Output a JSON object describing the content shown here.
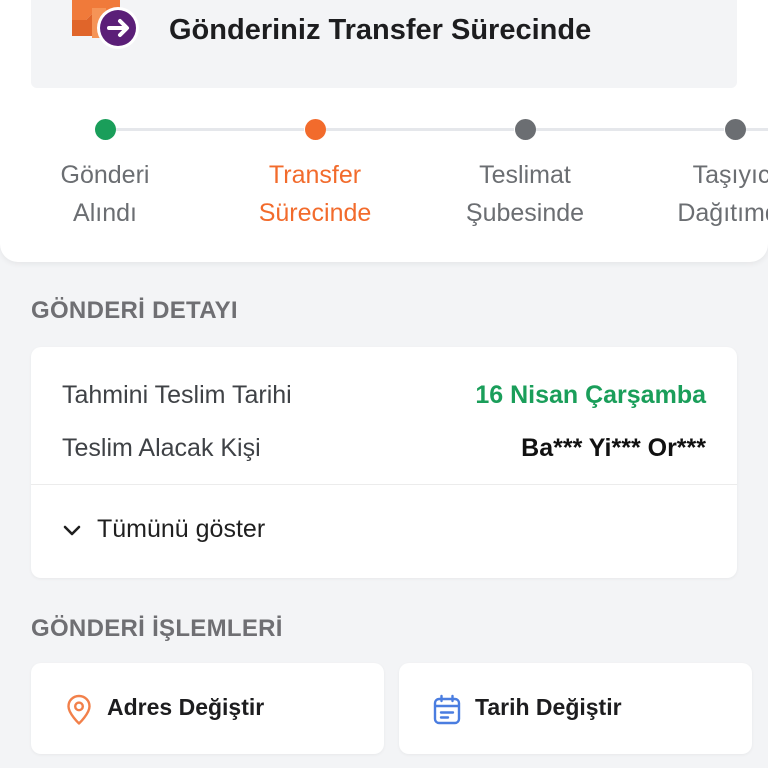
{
  "status": {
    "title": "Gönderiniz Transfer Sürecinde",
    "icon": "package-transfer-icon"
  },
  "tracking": {
    "steps": [
      {
        "line1": "Gönderi",
        "line2": "Alındı",
        "state": "completed",
        "color": "#1a9e5a"
      },
      {
        "line1": "Transfer",
        "line2": "Sürecinde",
        "state": "current",
        "color": "#f26b2c"
      },
      {
        "line1": "Teslimat",
        "line2": "Şubesinde",
        "state": "pending",
        "color": "#6b6e72"
      },
      {
        "line1": "Taşıyıcı",
        "line2": "Dağıtımda",
        "state": "pending",
        "color": "#6b6e72"
      }
    ]
  },
  "details": {
    "section_title": "GÖNDERİ DETAYI",
    "rows": [
      {
        "label": "Tahmini Teslim Tarihi",
        "value": "16 Nisan Çarşamba",
        "value_color": "#1a9e5a"
      },
      {
        "label": "Teslim Alacak Kişi",
        "value": "Ba*** Yi*** Or***",
        "value_color": "#111111"
      }
    ],
    "show_all_label": "Tümünü göster"
  },
  "actions": {
    "section_title": "GÖNDERİ İŞLEMLERİ",
    "change_address_label": "Adres Değiştir",
    "change_date_label": "Tarih Değiştir"
  },
  "colors": {
    "accent_orange": "#f26b2c",
    "success_green": "#1a9e5a",
    "pending_gray": "#6b6e72",
    "brand_purple": "#5b1f78",
    "calendar_blue": "#4a7de0"
  }
}
